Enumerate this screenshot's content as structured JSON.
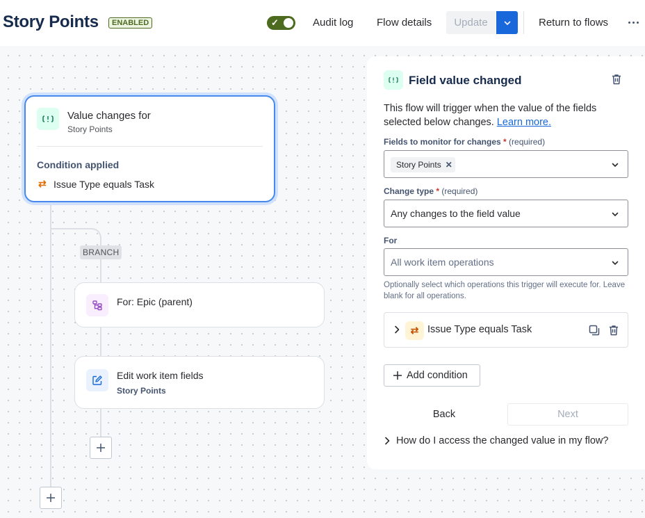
{
  "header": {
    "title": "Story Points",
    "status_badge": "ENABLED",
    "toggle_enabled": true,
    "audit_log": "Audit log",
    "flow_details": "Flow details",
    "update": "Update",
    "return_to_flows": "Return to flows",
    "more_icon": "more-horizontal-icon"
  },
  "canvas": {
    "trigger": {
      "icon": "field-value-icon",
      "title": "Value changes for",
      "subtitle": "Story Points",
      "condition_heading": "Condition applied",
      "condition_icon": "swap-arrows-icon",
      "condition_text": "Issue Type equals Task"
    },
    "branch_label": "BRANCH",
    "branch_step": {
      "icon": "hierarchy-icon",
      "title": "For: Epic (parent)"
    },
    "action_step": {
      "icon": "edit-icon",
      "title": "Edit work item fields",
      "subtitle": "Story Points"
    }
  },
  "panel": {
    "title": "Field value changed",
    "description": "This flow will trigger when the value of the fields selected below changes.",
    "learn_more": "Learn more.",
    "fields_label": "Fields to monitor for changes",
    "required_star": "*",
    "required_text": "(required)",
    "fields_selected": [
      "Story Points"
    ],
    "change_type_label": "Change type",
    "change_type_value": "Any changes to the field value",
    "for_label": "For",
    "for_placeholder": "All work item operations",
    "help_text": "Optionally select which operations this trigger will execute for. Leave blank for all operations.",
    "condition_text": "Issue Type equals Task",
    "add_condition": "Add condition",
    "back": "Back",
    "next": "Next",
    "faq": "How do I access the changed value in my flow?"
  },
  "colors": {
    "accent_blue": "#1868db",
    "enabled_green": "#4c6b1f",
    "selected_border": "#4688ec",
    "condition_orange": "#e06c00"
  }
}
